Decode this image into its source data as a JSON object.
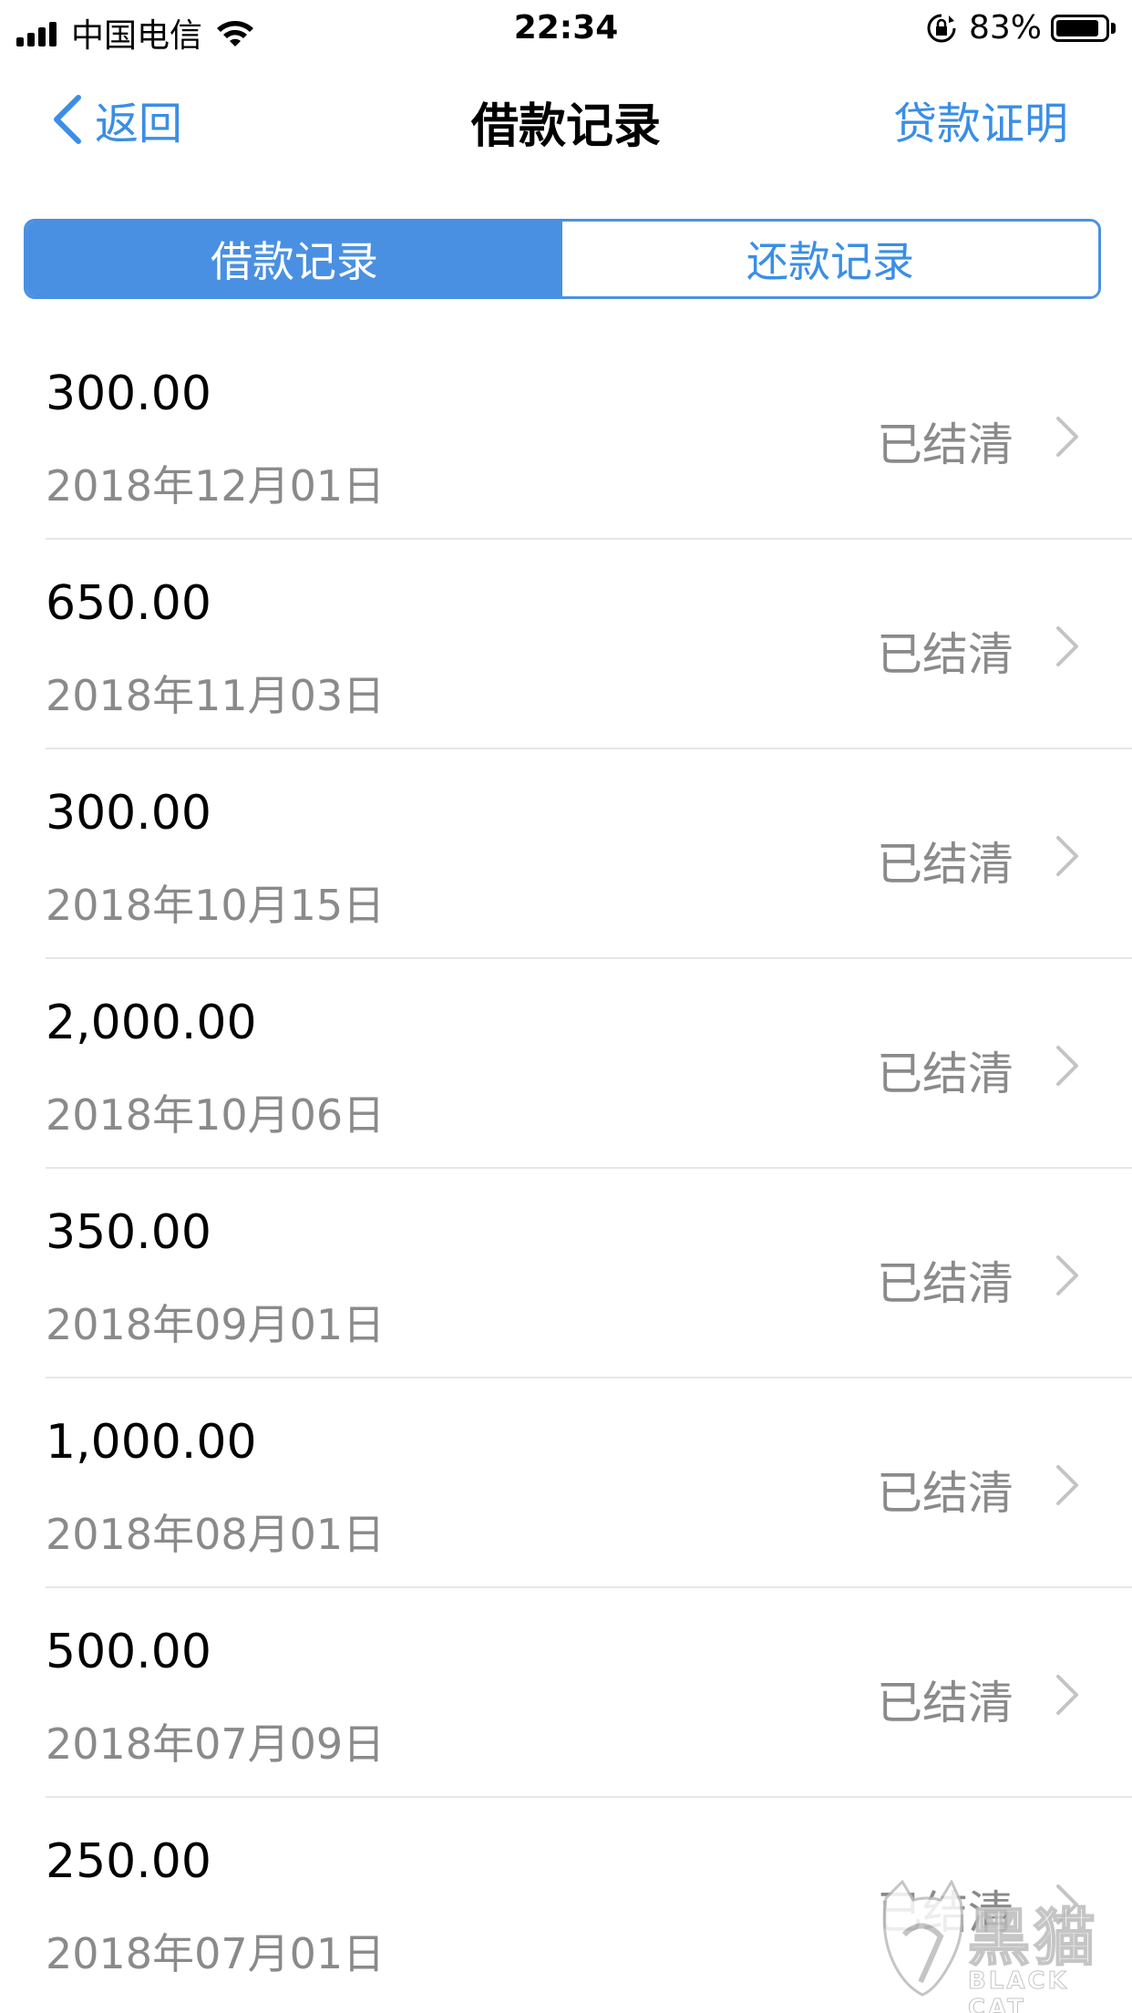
{
  "status_bar": {
    "carrier": "中国电信",
    "time": "22:34",
    "battery_percent": "83%",
    "battery_level": 0.83
  },
  "nav": {
    "back_label": "返回",
    "title": "借款记录",
    "right_action": "贷款证明"
  },
  "tabs": [
    {
      "label": "借款记录",
      "active": true
    },
    {
      "label": "还款记录",
      "active": false
    }
  ],
  "records": [
    {
      "amount": "300.00",
      "date": "2018年12月01日",
      "status": "已结清"
    },
    {
      "amount": "650.00",
      "date": "2018年11月03日",
      "status": "已结清"
    },
    {
      "amount": "300.00",
      "date": "2018年10月15日",
      "status": "已结清"
    },
    {
      "amount": "2,000.00",
      "date": "2018年10月06日",
      "status": "已结清"
    },
    {
      "amount": "350.00",
      "date": "2018年09月01日",
      "status": "已结清"
    },
    {
      "amount": "1,000.00",
      "date": "2018年08月01日",
      "status": "已结清"
    },
    {
      "amount": "500.00",
      "date": "2018年07月09日",
      "status": "已结清"
    },
    {
      "amount": "250.00",
      "date": "2018年07月01日",
      "status": "已结清"
    }
  ],
  "watermark": {
    "text": "黑猫",
    "subtext": "BLACK CAT"
  },
  "colors": {
    "accent": "#4a90e2",
    "link": "#3a8ee6",
    "secondary_text": "#8a8a8a"
  }
}
